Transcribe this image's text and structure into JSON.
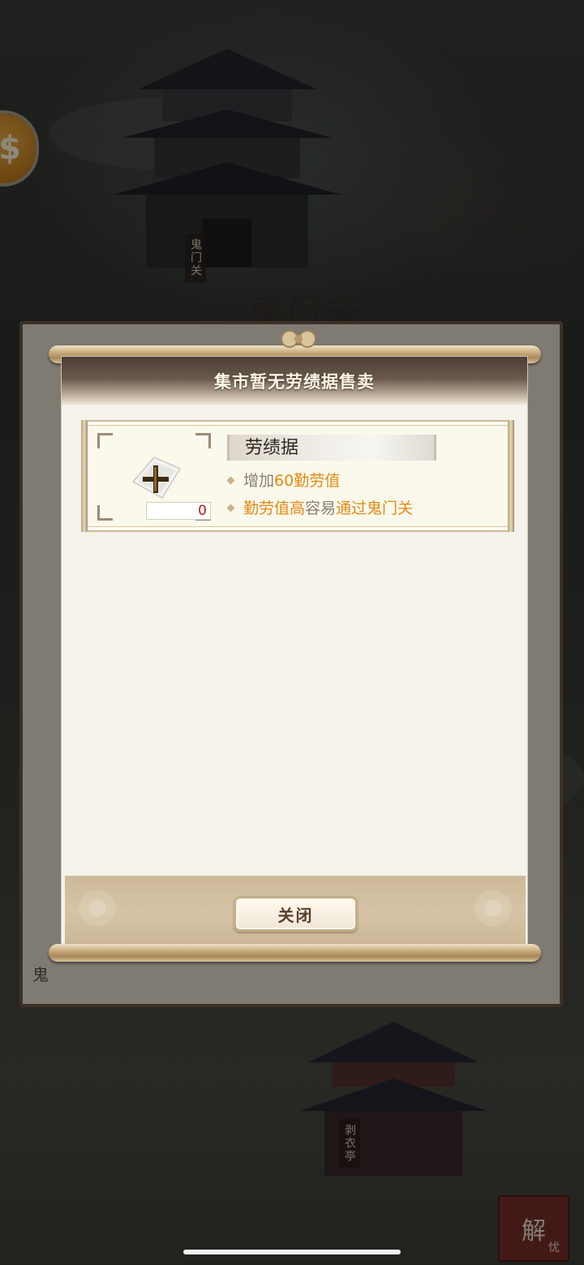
{
  "scene": {
    "label_top": "鬼门关",
    "label_bottom": "剥衣亭",
    "banner_title": "鬼门关",
    "background_panel_footer": "鬼",
    "stamp_main": "解",
    "stamp_sub": "忧"
  },
  "dialog": {
    "title": "集市暂无劳绩据售卖",
    "item": {
      "name": "劳绩据",
      "count": "0",
      "icon": "scroll-cross-icon",
      "desc_1": {
        "prefix": "增加",
        "highlight": "60勤劳值"
      },
      "desc_2": {
        "hl1": "勤劳值高",
        "middle": "容易",
        "hl2": "通过鬼门关"
      }
    },
    "close_label": "关闭"
  },
  "colors": {
    "highlight": "#e38a13",
    "count_red": "#b01b1b",
    "header_dark": "#4a3d34",
    "footer_tan": "#cdb999"
  }
}
